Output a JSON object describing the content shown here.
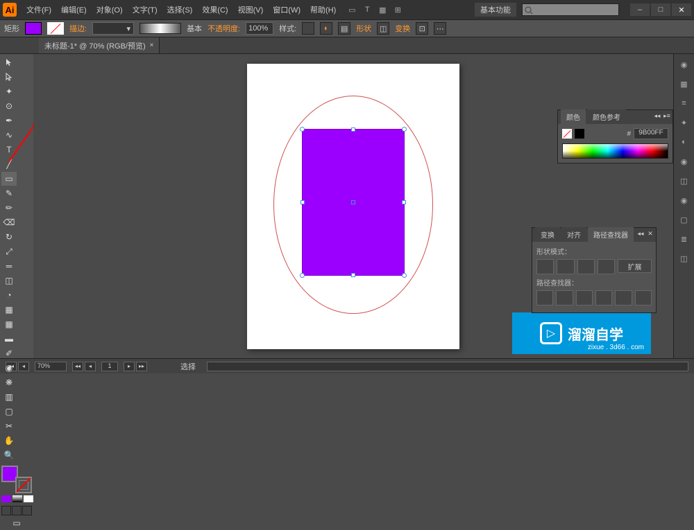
{
  "app": {
    "icon_text": "Ai"
  },
  "menu": [
    "文件(F)",
    "编辑(E)",
    "对象(O)",
    "文字(T)",
    "选择(S)",
    "效果(C)",
    "视图(V)",
    "窗口(W)",
    "帮助(H)"
  ],
  "title_right": {
    "basic": "基本功能",
    "search_placeholder": ""
  },
  "window_controls": {
    "min": "–",
    "max": "□",
    "close": "✕"
  },
  "control": {
    "shape": "矩形",
    "stroke_label": "描边:",
    "stroke_pt": " ",
    "style_label": "基本",
    "opacity_label": "不透明度:",
    "opacity_value": "100%",
    "style2_label": "样式:",
    "shape_btn": "形状",
    "transform_btn": "变换"
  },
  "tab": {
    "title": "未标题-1* @ 70% (RGB/预览)",
    "close": "×"
  },
  "color_panel": {
    "tabs": [
      "颜色",
      "颜色参考"
    ],
    "hex": "9B00FF"
  },
  "pathfinder": {
    "tabs": [
      "变换",
      "对齐",
      "路径查找器"
    ],
    "shape_mode": "形状模式：",
    "expand": "扩展",
    "pathfinder_label": "路径查找器："
  },
  "status": {
    "zoom": "70%",
    "page": "1",
    "tool": "选择"
  },
  "watermark": {
    "text": "溜溜自学",
    "url": "zixue . 3d66 . com"
  },
  "colors": {
    "fill": "#9B00FF"
  }
}
